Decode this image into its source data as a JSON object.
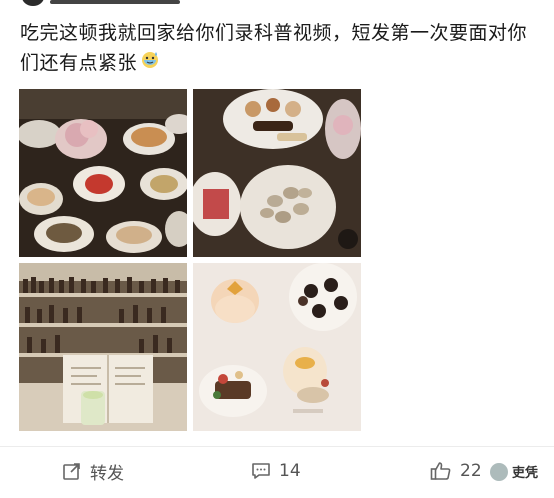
{
  "post": {
    "text": "吃完这顿我就回家给你们录科普视频，短发第一次要面对你们还有点紧张",
    "emoji": "sweat-smile-emoji"
  },
  "photos": [
    {
      "label": "dim-sum-table-photo"
    },
    {
      "label": "dessert-platter-photo"
    },
    {
      "label": "bar-interior-photo"
    },
    {
      "label": "plated-desserts-photo"
    }
  ],
  "actions": {
    "repost_label": "转发",
    "comment_count": "14",
    "like_count": "22"
  },
  "watermark": {
    "text": "吏凭"
  },
  "icons": {
    "repost": "repost-icon",
    "comment": "comment-icon",
    "like": "thumbs-up-icon"
  },
  "colors": {
    "text": "#1a1a1a",
    "action_text": "#555555",
    "divider": "#ececec"
  }
}
